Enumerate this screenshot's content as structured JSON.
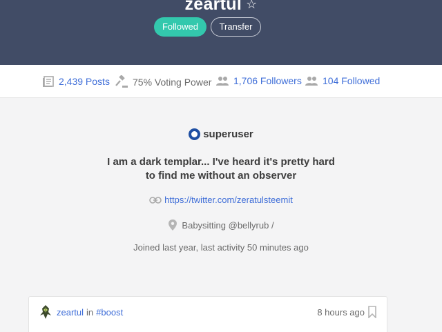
{
  "header": {
    "username": "zeartul",
    "star_icon": "☆",
    "followed_label": "Followed",
    "transfer_label": "Transfer"
  },
  "stats": {
    "posts": "2,439 Posts",
    "voting_power": "75% Voting Power",
    "followers": "1,706 Followers",
    "followed": "104 Followed"
  },
  "profile": {
    "badge": "superuser",
    "bio_line1": "I am a dark templar... I've heard it's pretty hard",
    "bio_line2": "to find me without an observer",
    "website": "https://twitter.com/zeratulsteemit",
    "location": "Babysitting @bellyrub /",
    "joined": "Joined last year, last activity 50 minutes ago"
  },
  "post": {
    "author": "zeartul",
    "in_label": "in",
    "tag": "#boost",
    "time": "8 hours ago"
  },
  "colors": {
    "header_bg": "#414c66",
    "accent_green": "#33c8ad",
    "link_blue": "#3f6ed8",
    "badge_blue": "#1f4fa3"
  },
  "icons": [
    "star-icon",
    "posts-icon",
    "gavel-icon",
    "followers-icon",
    "followed-icon",
    "link-icon",
    "location-pin-icon",
    "bookmark-icon"
  ]
}
